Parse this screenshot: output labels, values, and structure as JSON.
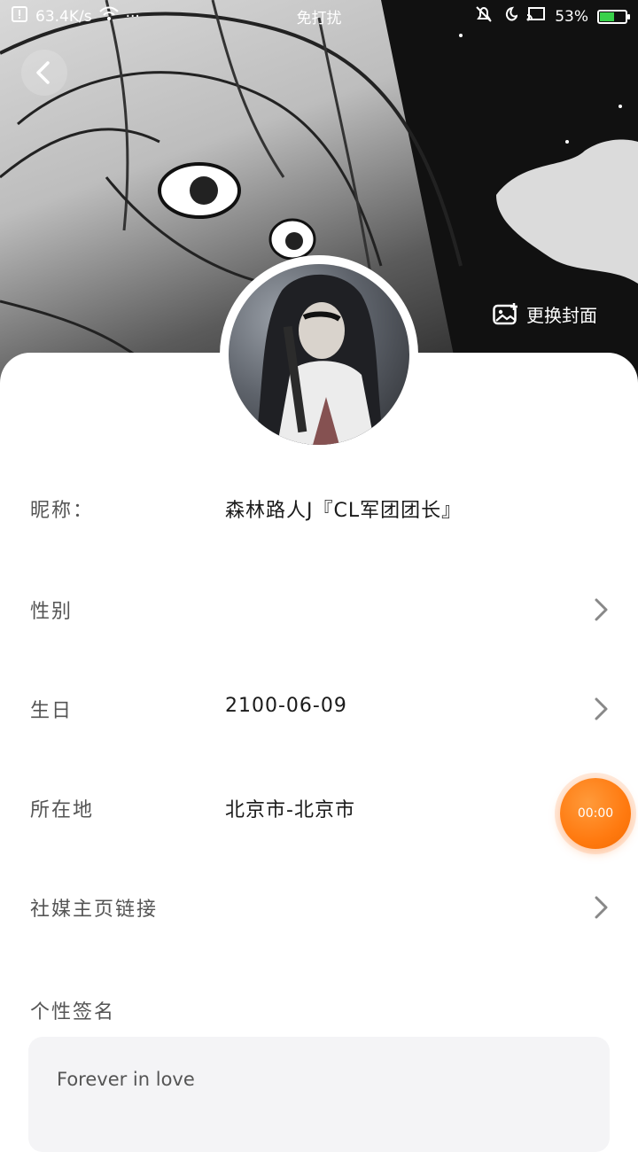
{
  "status_bar": {
    "speed": "63.4K/s",
    "dots": "···",
    "mode": "免打扰",
    "battery": "53%",
    "battery_level": 0.53
  },
  "header": {
    "change_cover_label": "更换封面"
  },
  "profile": {
    "fields": [
      {
        "label": "昵称：",
        "value": "森林路人J『CL军团团长』",
        "chevron": false
      },
      {
        "label": "性别",
        "value": "",
        "chevron": true
      },
      {
        "label": "生日",
        "value": "2100-06-09",
        "chevron": true
      },
      {
        "label": "所在地",
        "value": "北京市-北京市",
        "chevron": false
      },
      {
        "label": "社媒主页链接",
        "value": "",
        "chevron": true
      }
    ],
    "signature_label": "个性签名",
    "signature_value": "Forever in love"
  },
  "floating_timer": "00:00",
  "colors": {
    "timer": "#ff7a10",
    "battery_fill": "#39d14a"
  }
}
